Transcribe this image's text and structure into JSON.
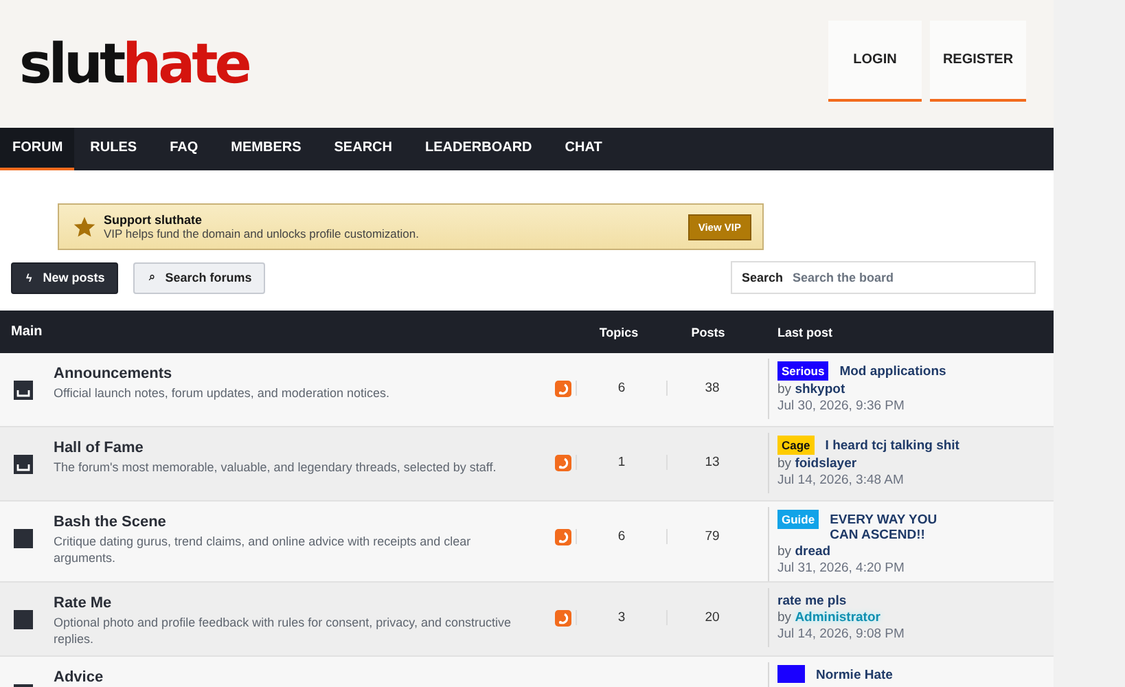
{
  "logo": {
    "first": "slut",
    "second": "hate"
  },
  "account_buttons": [
    "LOGIN",
    "REGISTER"
  ],
  "nav": [
    {
      "label": "FORUM",
      "selected": true
    },
    {
      "label": "RULES",
      "selected": false
    },
    {
      "label": "FAQ",
      "selected": false
    },
    {
      "label": "MEMBERS",
      "selected": false
    },
    {
      "label": "SEARCH",
      "selected": false
    },
    {
      "label": "LEADERBOARD",
      "selected": false
    },
    {
      "label": "CHAT",
      "selected": false
    }
  ],
  "banner": {
    "title": "Support sluthate",
    "text": "VIP helps fund the domain and unlocks profile customization.",
    "button": "View VIP"
  },
  "actions": [
    {
      "icon": "ϟ",
      "label": "New posts",
      "kind": "primary"
    },
    {
      "icon": "⌕",
      "label": "Search forums",
      "kind": "secondary"
    }
  ],
  "search": {
    "label": "Search",
    "placeholder": "Search the board"
  },
  "table": {
    "columns": [
      "Main",
      "Topics",
      "Posts",
      "Last post"
    ],
    "rows": [
      {
        "kind": "tray",
        "name": "Announcements",
        "description": "Official launch notes, forum updates, and moderation notices.",
        "topics": "6",
        "posts": "38",
        "last_post": {
          "tag": {
            "label": "Serious",
            "color": "#1a00ff"
          },
          "title": "Mod applications",
          "by": "by",
          "user": "shkypot",
          "highlight": false,
          "time": "Jul 30, 2026, 9:36 PM"
        }
      },
      {
        "kind": "tray",
        "name": "Hall of Fame",
        "description": "The forum's most memorable, valuable, and legendary threads, selected by staff.",
        "topics": "1",
        "posts": "13",
        "last_post": {
          "tag": {
            "label": "Cage",
            "color": "#ffcc00"
          },
          "title": "I heard tcj talking shit",
          "by": "by",
          "user": "foidslayer",
          "highlight": false,
          "time": "Jul 14, 2026, 3:48 AM"
        }
      },
      {
        "kind": "square",
        "name": "Bash the Scene",
        "description": "Critique dating gurus, trend claims, and online advice with receipts and clear arguments.",
        "topics": "6",
        "posts": "79",
        "last_post": {
          "tag": {
            "label": "Guide",
            "color": "#12a3e8"
          },
          "title": "EVERY WAY YOU CAN ASCEND!!",
          "by": "by",
          "user": "dread",
          "highlight": false,
          "time": "Jul 31, 2026, 4:20 PM"
        }
      },
      {
        "kind": "square",
        "name": "Rate Me",
        "description": "Optional photo and profile feedback with rules for consent, privacy, and constructive replies.",
        "topics": "3",
        "posts": "20",
        "last_post": {
          "title": "rate me pls",
          "by": "by",
          "user": "Administrator",
          "highlight": true,
          "time": "Jul 14, 2026, 9:08 PM"
        }
      },
      {
        "kind": "square",
        "name": "Advice",
        "last_post": {
          "tag": {
            "color": "#1a00ff"
          },
          "title": "Normie Hate"
        }
      }
    ]
  }
}
